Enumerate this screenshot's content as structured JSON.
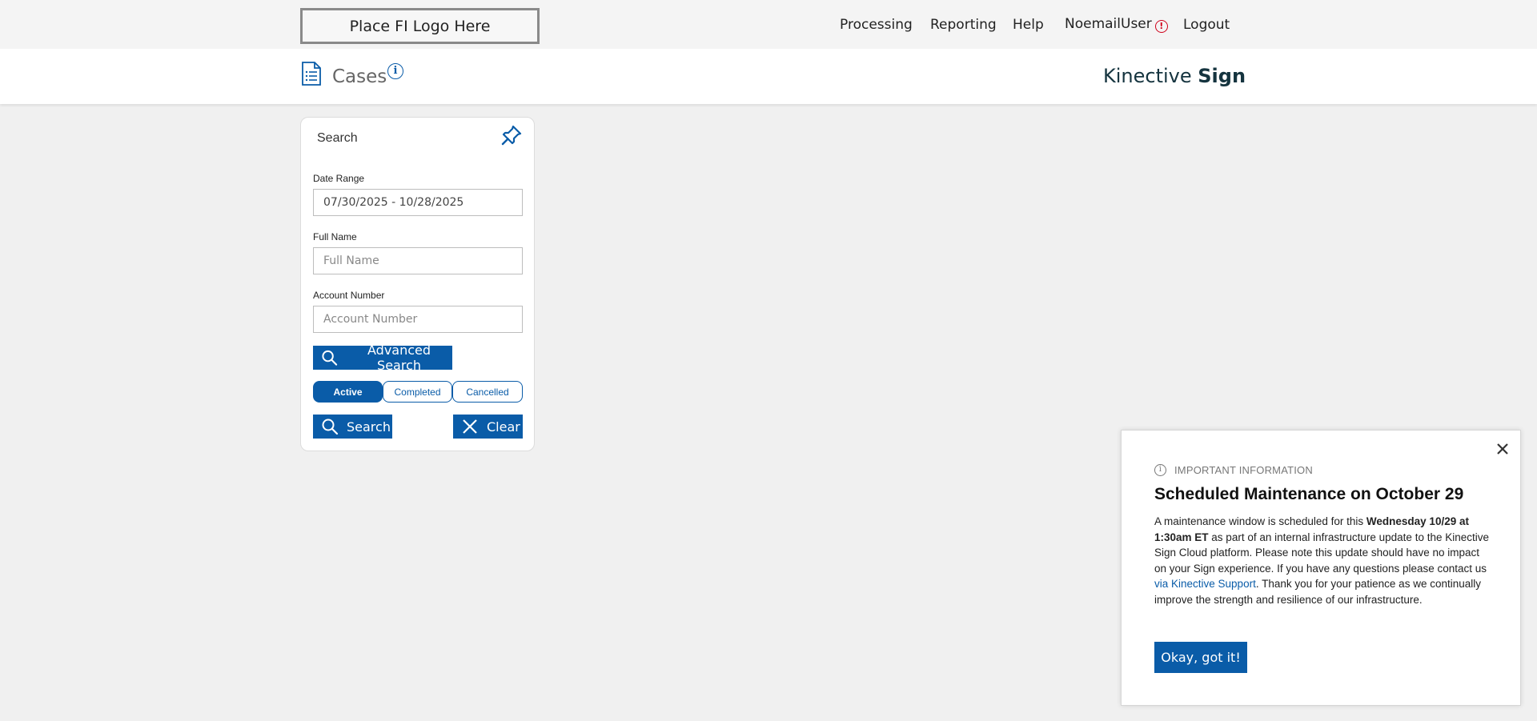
{
  "header": {
    "logo_text": "Place FI Logo Here",
    "nav": {
      "processing": "Processing",
      "reporting": "Reporting",
      "help": "Help",
      "user": "NoemailUser",
      "logout": "Logout"
    },
    "alert_icon": "exclamation-circle-icon"
  },
  "subheader": {
    "page_title": "Cases",
    "brand_light": "Kinective ",
    "brand_bold": "Sign"
  },
  "search_panel": {
    "title": "Search",
    "date_range": {
      "label": "Date Range",
      "value": "07/30/2025 - 10/28/2025"
    },
    "full_name": {
      "label": "Full Name",
      "placeholder": "Full Name",
      "value": ""
    },
    "account_number": {
      "label": "Account Number",
      "placeholder": "Account Number",
      "value": ""
    },
    "advanced_search_label": "Advanced Search",
    "status_tabs": [
      {
        "label": "Active",
        "active": true
      },
      {
        "label": "Completed",
        "active": false
      },
      {
        "label": "Cancelled",
        "active": false
      }
    ],
    "search_label": "Search",
    "clear_label": "Clear"
  },
  "notice": {
    "kicker": "IMPORTANT INFORMATION",
    "title": "Scheduled Maintenance on October 29",
    "body_pre": "A maintenance window is scheduled for this ",
    "body_bold": "Wednesday 10/29 at 1:30am ET",
    "body_mid": " as part of an internal infrastructure update to the Kinective Sign Cloud platform. Please note this update should have no impact on your Sign experience. If you have any questions please contact us ",
    "body_link": "via Kinective Support",
    "body_post": ". Thank you for your patience as we continually improve the strength and resilience of our infrastructure.",
    "ok_label": "Okay, got it!"
  },
  "colors": {
    "accent": "#0a5ca8",
    "brand_text": "#15343f",
    "alert": "#d0021b"
  }
}
